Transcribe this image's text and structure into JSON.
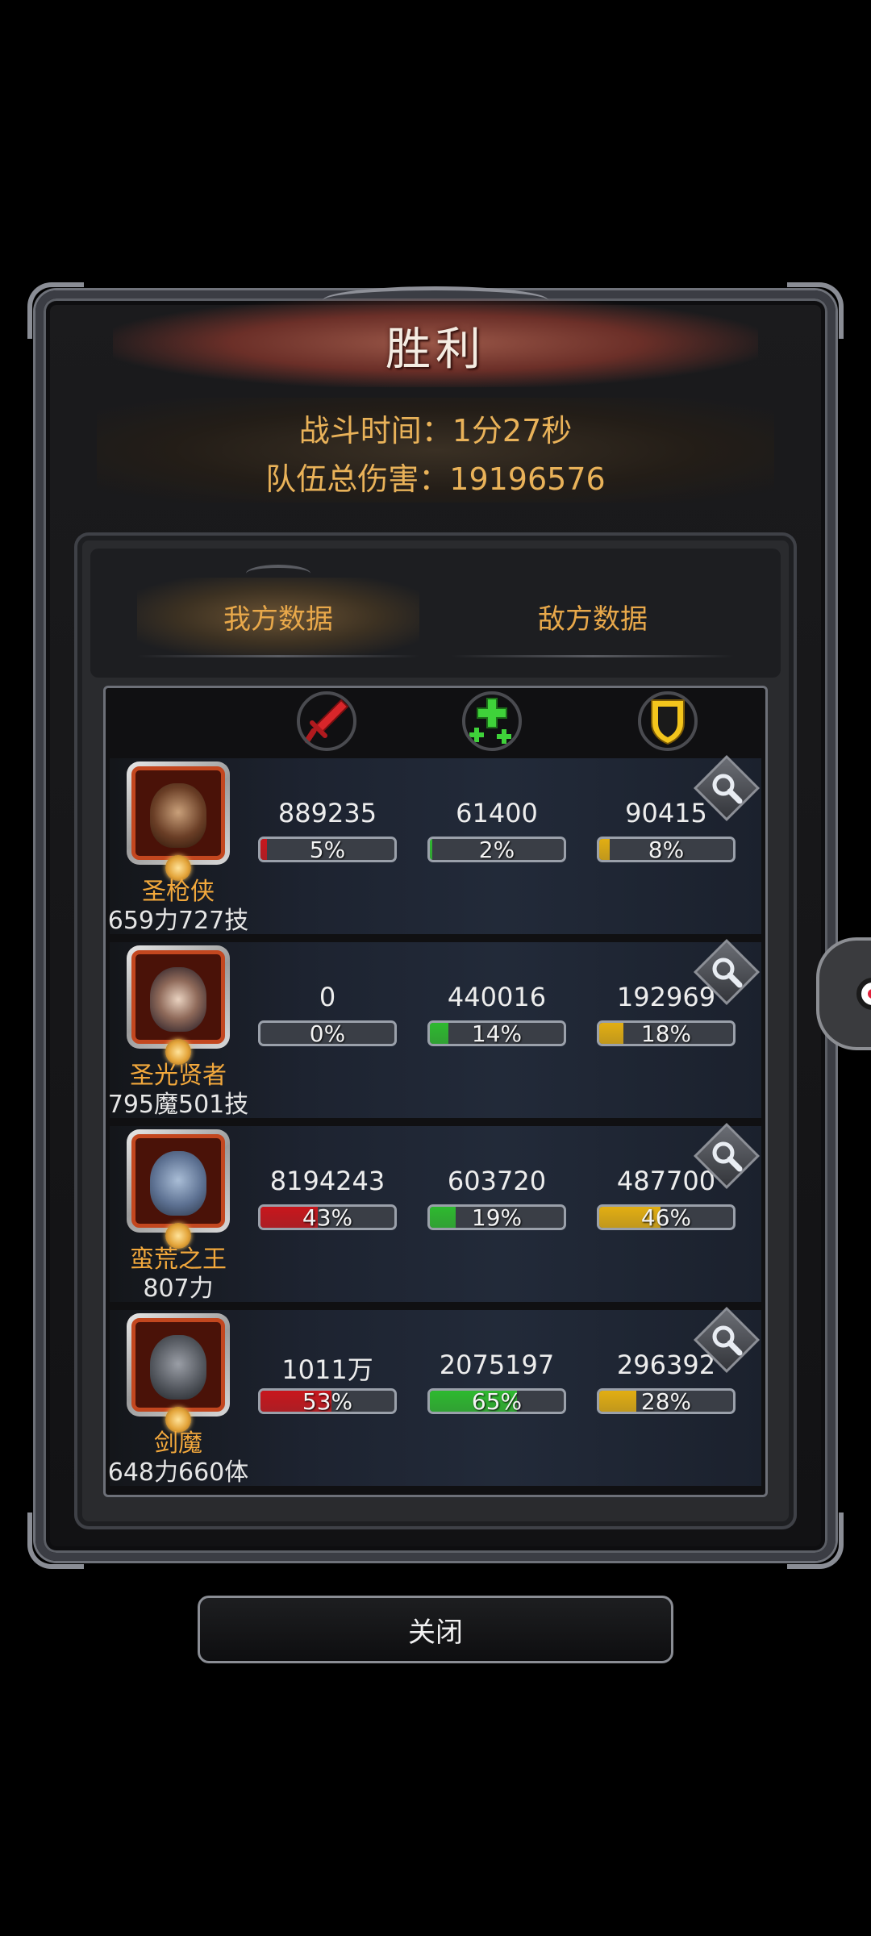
{
  "dialog": {
    "title": "胜利",
    "battle_time": "战斗时间：1分27秒",
    "total_damage": "队伍总伤害：19196576"
  },
  "tabs": [
    {
      "label": "我方数据",
      "active": true
    },
    {
      "label": "敌方数据",
      "active": false
    }
  ],
  "columns": [
    {
      "icon": "sword-icon",
      "color": "#d8262a"
    },
    {
      "icon": "heal-cross-icon",
      "color": "#3fd23a"
    },
    {
      "icon": "shield-icon",
      "color": "#f3c51c"
    }
  ],
  "heroes": [
    {
      "name": "圣枪侠",
      "attr": "659力727技",
      "damage": {
        "value": "889235",
        "pct": "5%",
        "fraction": 0.05
      },
      "heal": {
        "value": "61400",
        "pct": "2%",
        "fraction": 0.02
      },
      "tank": {
        "value": "90415",
        "pct": "8%",
        "fraction": 0.08
      }
    },
    {
      "name": "圣光贤者",
      "attr": "795魔501技",
      "damage": {
        "value": "0",
        "pct": "0%",
        "fraction": 0.0
      },
      "heal": {
        "value": "440016",
        "pct": "14%",
        "fraction": 0.14
      },
      "tank": {
        "value": "192969",
        "pct": "18%",
        "fraction": 0.18
      }
    },
    {
      "name": "蛮荒之王",
      "attr": "807力",
      "damage": {
        "value": "8194243",
        "pct": "43%",
        "fraction": 0.43
      },
      "heal": {
        "value": "603720",
        "pct": "19%",
        "fraction": 0.19
      },
      "tank": {
        "value": "487700",
        "pct": "46%",
        "fraction": 0.46
      }
    },
    {
      "name": "剑魔",
      "attr": "648力660体",
      "damage": {
        "value": "1011万",
        "pct": "53%",
        "fraction": 0.53
      },
      "heal": {
        "value": "2075197",
        "pct": "65%",
        "fraction": 0.65
      },
      "tank": {
        "value": "296392",
        "pct": "28%",
        "fraction": 0.28
      }
    }
  ],
  "close_label": "关闭",
  "colors": {
    "damage_bar": "#c8161c",
    "heal_bar": "#2eb92f",
    "tank_bar": "#e2ae12",
    "name_text": "#f2a83c",
    "info_text": "#e9b259"
  }
}
